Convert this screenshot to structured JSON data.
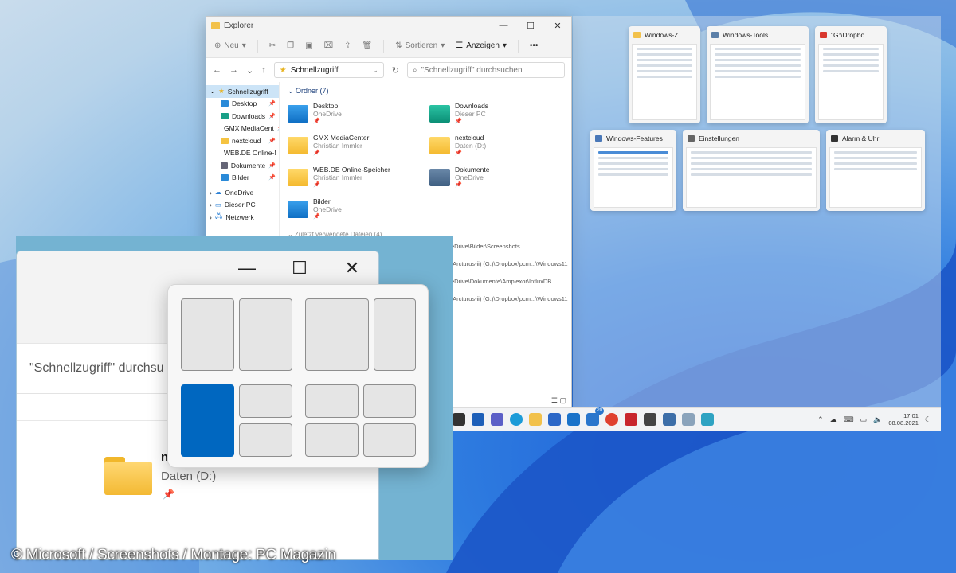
{
  "explorer": {
    "title": "Explorer",
    "toolbar": {
      "new_label": "Neu",
      "sort_label": "Sortieren",
      "view_label": "Anzeigen",
      "more_label": "•••"
    },
    "address": "Schnellzugriff",
    "search_placeholder": "\"Schnellzugriff\" durchsuchen",
    "sidebar": [
      {
        "label": "Schnellzugriff",
        "selected": true,
        "root": true,
        "icon": "star-icon"
      },
      {
        "label": "Desktop",
        "pinned": true,
        "icon": "desktop-folder-icon"
      },
      {
        "label": "Downloads",
        "pinned": true,
        "icon": "downloads-folder-icon"
      },
      {
        "label": "GMX MediaCent",
        "pinned": true,
        "icon": "folder-icon"
      },
      {
        "label": "nextcloud",
        "pinned": true,
        "icon": "folder-icon"
      },
      {
        "label": "WEB.DE Online-!",
        "pinned": true,
        "icon": "folder-icon"
      },
      {
        "label": "Dokumente",
        "pinned": true,
        "icon": "documents-folder-icon"
      },
      {
        "label": "Bilder",
        "pinned": true,
        "icon": "pictures-folder-icon"
      },
      {
        "label": "OneDrive",
        "root": true,
        "icon": "cloud-icon"
      },
      {
        "label": "Dieser PC",
        "root": true,
        "icon": "pc-icon"
      },
      {
        "label": "Netzwerk",
        "root": true,
        "icon": "network-icon"
      }
    ],
    "group_heading": "Ordner (7)",
    "tiles": [
      {
        "name": "Desktop",
        "sub": "OneDrive",
        "color": "b"
      },
      {
        "name": "Downloads",
        "sub": "Dieser PC",
        "color": "g"
      },
      {
        "name": "GMX MediaCenter",
        "sub": "Christian Immler",
        "color": "y"
      },
      {
        "name": "nextcloud",
        "sub": "Daten (D:)",
        "color": "y"
      },
      {
        "name": "WEB.DE Online-Speicher",
        "sub": "Christian Immler",
        "color": "y"
      },
      {
        "name": "Dokumente",
        "sub": "OneDrive",
        "color": "s"
      },
      {
        "name": "Bilder",
        "sub": "OneDrive",
        "color": "b"
      }
    ],
    "recent_heading": "Zuletzt verwendete Dateien (4)",
    "recent_paths": [
      "eDrive\\Bilder\\Screenshots",
      "\\Arcturus-ii) (G:)\\Dropbox\\pcm...\\Windows11",
      "eDrive\\Dokumente\\Amplexor\\InfluxDB",
      "\\Arcturus-ii) (G:)\\Dropbox\\pcm...\\Windows11"
    ]
  },
  "taskview": {
    "cards": [
      {
        "title": "Windows-Z...",
        "icon_color": "#f2c14b"
      },
      {
        "title": "Windows-Tools",
        "icon_color": "#5b7fa8"
      },
      {
        "title": "\"G:\\Dropbo...",
        "icon_color": "#d9382e"
      },
      {
        "title": "Windows-Features",
        "icon_color": "#4a78b8"
      },
      {
        "title": "Einstellungen",
        "icon_color": "#666666"
      },
      {
        "title": "Alarm & Uhr",
        "icon_color": "#333333"
      }
    ]
  },
  "taskbar": {
    "mail_badge": "20",
    "time": "17:01",
    "date": "08.08.2021"
  },
  "zoom": {
    "search_text": "\"Schnellzugriff\" durchsu",
    "folder_name": "n",
    "folder_sub": "Daten (D:)",
    "minimize_glyph": "—",
    "maximize_glyph": "☐",
    "close_glyph": "✕"
  },
  "snap_layouts": {
    "active_zone": "layout-3-left"
  },
  "credit": "© Microsoft / Screenshots / Montage: PC Magazin"
}
